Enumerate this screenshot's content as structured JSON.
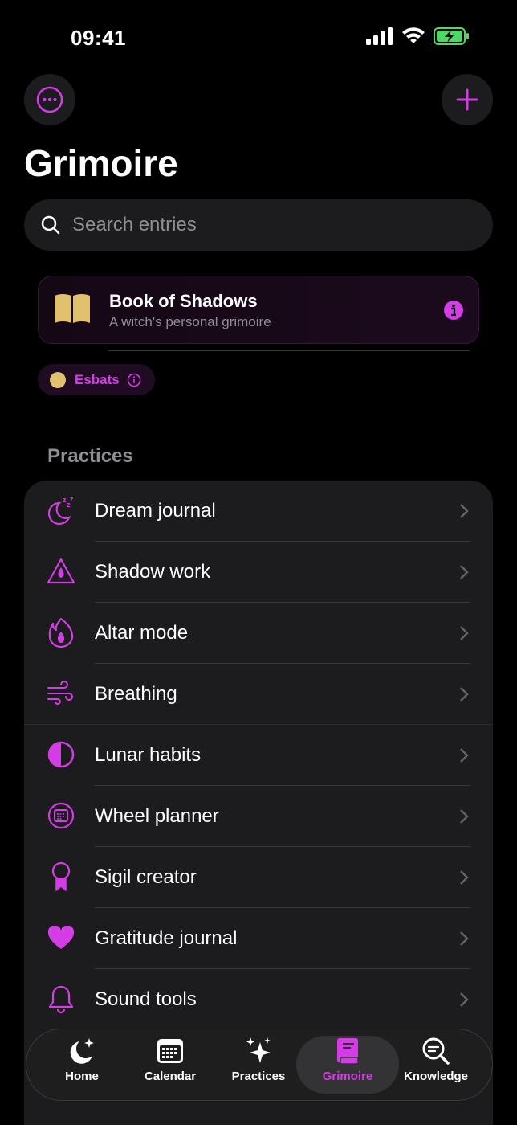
{
  "status_bar": {
    "time": "09:41"
  },
  "header": {
    "title": "Grimoire"
  },
  "search": {
    "placeholder": "Search entries"
  },
  "book_card": {
    "title": "Book of Shadows",
    "subtitle": "A witch's personal grimoire"
  },
  "filter_chip": {
    "label": "Esbats"
  },
  "practices": {
    "section_title": "Practices",
    "items": [
      {
        "label": "Dream journal",
        "icon": "moon-zzz-icon"
      },
      {
        "label": "Shadow work",
        "icon": "warning-drop-icon"
      },
      {
        "label": "Altar mode",
        "icon": "flame-icon"
      },
      {
        "label": "Breathing",
        "icon": "wind-icon"
      },
      {
        "label": "Lunar habits",
        "icon": "half-circle-icon"
      },
      {
        "label": "Wheel planner",
        "icon": "calendar-circle-icon"
      },
      {
        "label": "Sigil creator",
        "icon": "rosette-icon"
      },
      {
        "label": "Gratitude journal",
        "icon": "heart-icon"
      },
      {
        "label": "Sound tools",
        "icon": "bell-icon"
      }
    ]
  },
  "tab_bar": {
    "tabs": [
      {
        "label": "Home",
        "icon": "moon-stars-icon"
      },
      {
        "label": "Calendar",
        "icon": "calendar-icon"
      },
      {
        "label": "Practices",
        "icon": "sparkles-icon"
      },
      {
        "label": "Grimoire",
        "icon": "book-icon",
        "active": true
      },
      {
        "label": "Knowledge",
        "icon": "magnifier-icon"
      }
    ]
  },
  "colors": {
    "accent": "#d43ce5",
    "background": "#000000",
    "surface": "#1c1c1e",
    "gold": "#e1c16e"
  }
}
